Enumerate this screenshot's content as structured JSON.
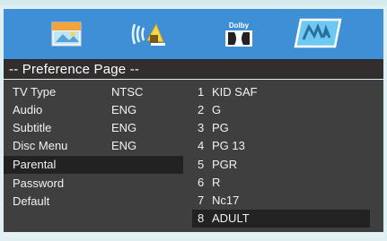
{
  "tabs": [
    {
      "name": "general-setup",
      "icon": "flag-icon",
      "label": ""
    },
    {
      "name": "audio-setup",
      "icon": "speaker-icon",
      "label": ""
    },
    {
      "name": "dolby-setup",
      "icon": "dolby-icon",
      "label": "Dolby"
    },
    {
      "name": "preference-setup",
      "icon": "preference-icon",
      "label": "",
      "active": true
    }
  ],
  "page_title": "-- Preference Page --",
  "menu": [
    {
      "label": "TV Type",
      "value": "NTSC"
    },
    {
      "label": "Audio",
      "value": "ENG"
    },
    {
      "label": "Subtitle",
      "value": "ENG"
    },
    {
      "label": "Disc Menu",
      "value": "ENG"
    },
    {
      "label": "Parental",
      "value": "",
      "selected": true
    },
    {
      "label": "Password",
      "value": ""
    },
    {
      "label": "Default",
      "value": ""
    }
  ],
  "options": [
    {
      "num": "1",
      "label": "KID  SAF"
    },
    {
      "num": "2",
      "label": "G"
    },
    {
      "num": "3",
      "label": "PG"
    },
    {
      "num": "4",
      "label": "PG  13"
    },
    {
      "num": "5",
      "label": "PGR"
    },
    {
      "num": "6",
      "label": "R"
    },
    {
      "num": "7",
      "label": "Nc17"
    },
    {
      "num": "8",
      "label": "ADULT",
      "selected": true
    }
  ],
  "colors": {
    "tab_bar": "#3e8fd6",
    "title_bar": "#332e2e",
    "panel": "#3f3f3f",
    "selection": "#222222",
    "text": "#f2f2f2"
  }
}
